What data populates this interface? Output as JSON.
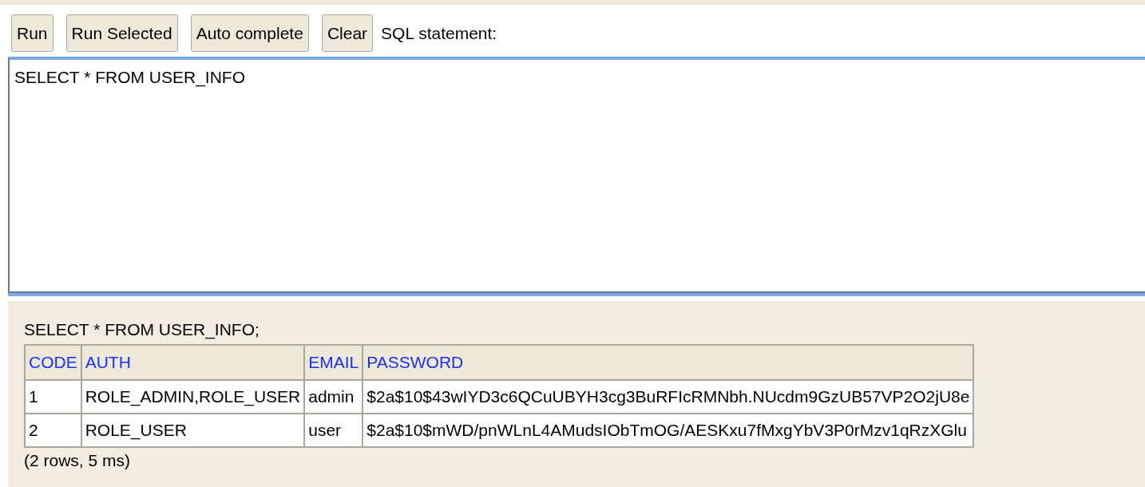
{
  "toolbar": {
    "buttons": [
      "Run",
      "Run Selected",
      "Auto complete",
      "Clear"
    ],
    "label": "SQL statement:"
  },
  "editor": {
    "value": "SELECT * FROM USER_INFO"
  },
  "result": {
    "statement": "SELECT * FROM USER_INFO;",
    "table": {
      "columns": [
        "CODE",
        "AUTH",
        "EMAIL",
        "PASSWORD"
      ],
      "rows": [
        [
          "1",
          "ROLE_ADMIN,ROLE_USER",
          "admin",
          "$2a$10$43wIYD3c6QCuUBYH3cg3BuRFIcRMNbh.NUcdm9GzUB57VP2O2jU8e"
        ],
        [
          "2",
          "ROLE_USER",
          "user",
          "$2a$10$mWD/pnWLnL4AMudsIObTmOG/AESKxu7fMxgYbV3P0rMzv1qRzXGlu"
        ]
      ]
    },
    "summary": "(2 rows, 5 ms)"
  }
}
